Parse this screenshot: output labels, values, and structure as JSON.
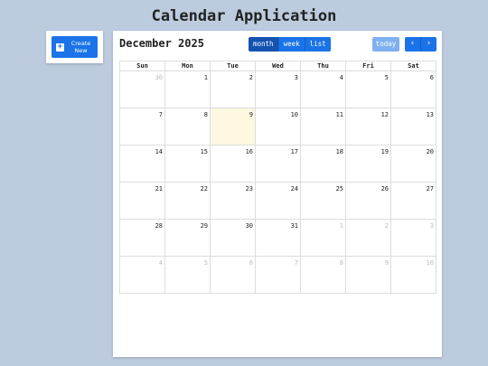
{
  "app": {
    "title": "Calendar Application"
  },
  "sidebar": {
    "create_label": "Create New",
    "create_icon": "plus-icon"
  },
  "toolbar": {
    "month_title": "December 2025",
    "views": [
      "month",
      "week",
      "list"
    ],
    "active_view": "month",
    "today_label": "today",
    "prev_icon": "chevron-left-icon",
    "next_icon": "chevron-right-icon"
  },
  "calendar": {
    "weekdays": [
      "Sun",
      "Mon",
      "Tue",
      "Wed",
      "Thu",
      "Fri",
      "Sat"
    ],
    "weeks": [
      [
        "30",
        "1",
        "2",
        "3",
        "4",
        "5",
        "6"
      ],
      [
        "7",
        "8",
        "9",
        "10",
        "11",
        "12",
        "13"
      ],
      [
        "14",
        "15",
        "16",
        "17",
        "18",
        "19",
        "20"
      ],
      [
        "21",
        "22",
        "23",
        "24",
        "25",
        "26",
        "27"
      ],
      [
        "28",
        "29",
        "30",
        "31",
        "1",
        "2",
        "3"
      ],
      [
        "4",
        "5",
        "6",
        "7",
        "8",
        "9",
        "10"
      ]
    ],
    "today": "9"
  },
  "colors": {
    "background": "#bccbde",
    "accent": "#1a73e8",
    "active_view": "#1453b0",
    "today_button": "#7fb0ef",
    "today_highlight": "#fef8e1"
  }
}
